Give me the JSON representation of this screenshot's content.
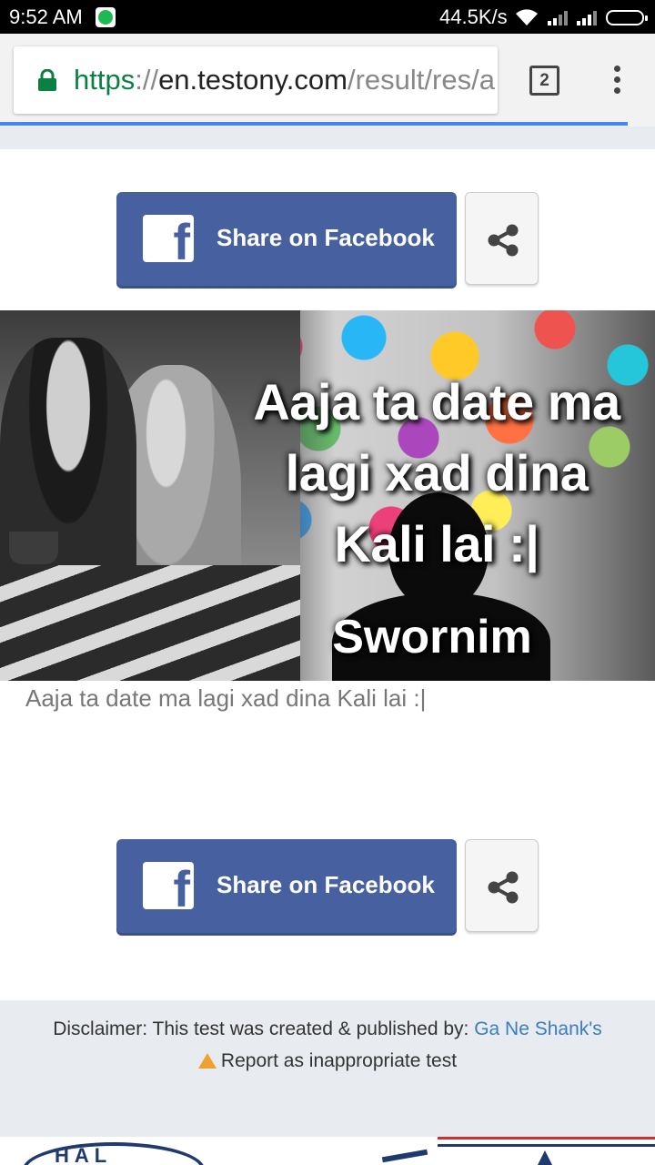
{
  "status_bar": {
    "time": "9:52  AM",
    "net_speed": "44.5K/s"
  },
  "browser": {
    "url_scheme": "https",
    "url_sep": "://",
    "url_host": "en.testony.com",
    "url_path": "/result/res/a",
    "tab_count": "2"
  },
  "share_top": {
    "facebook_label": "Share on Facebook"
  },
  "result": {
    "image_caption_lines": [
      "Aaja ta date ma",
      "lagi xad dina",
      "Kali lai :|"
    ],
    "image_author": "Swornim",
    "text": "Aaja ta date ma lagi xad dina Kali lai :|"
  },
  "share_bottom": {
    "facebook_label": "Share on Facebook"
  },
  "footer": {
    "disclaimer_prefix": "Disclaimer: This test was created & published by: ",
    "creator_name": "Ga Ne Shank's",
    "report_label": "Report as inappropriate test"
  },
  "ad": {
    "partial_text": "HAL"
  },
  "colors": {
    "facebook_blue": "#47609f",
    "link_blue": "#3a7ec0",
    "url_green": "#0b8043",
    "progress_blue": "#4285f4",
    "warning_orange": "#f0a030"
  }
}
